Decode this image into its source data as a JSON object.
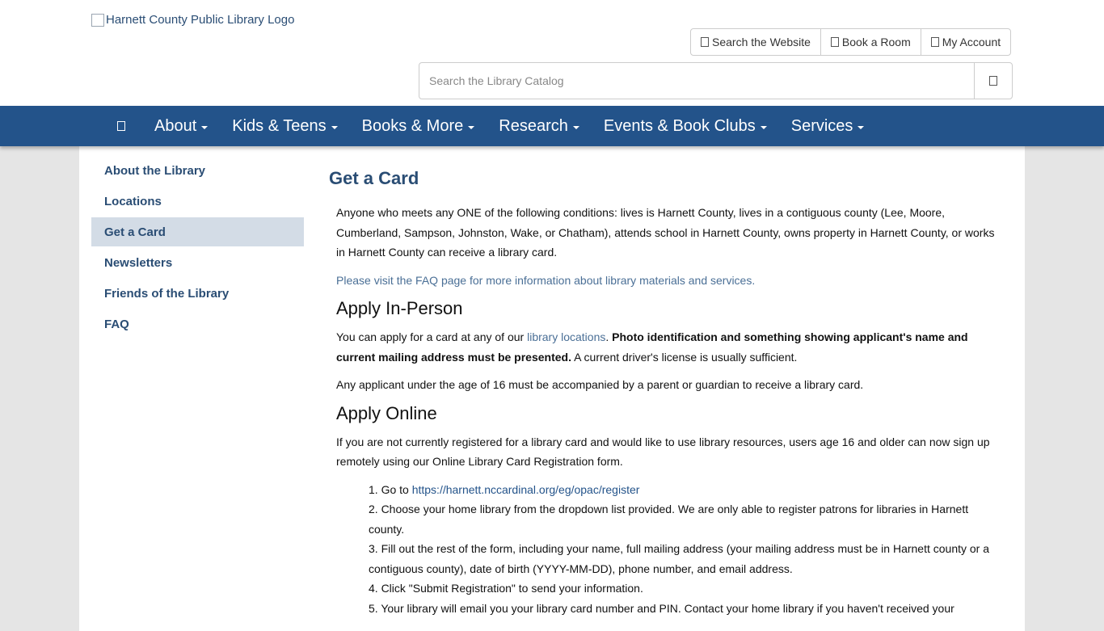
{
  "header": {
    "logo_alt": "Harnett County Public Library Logo",
    "util_buttons": [
      "Search the Website",
      "Book a Room",
      "My Account"
    ],
    "search_placeholder": "Search the Library Catalog"
  },
  "nav": {
    "items": [
      "About",
      "Kids & Teens",
      "Books & More",
      "Research",
      "Events & Book Clubs",
      "Services"
    ]
  },
  "sidebar": {
    "items": [
      "About the Library",
      "Locations",
      "Get a Card",
      "Newsletters",
      "Friends of the Library",
      "FAQ"
    ],
    "active": "Get a Card"
  },
  "main": {
    "title": "Get a Card",
    "intro": "Anyone who meets any ONE of the following conditions: lives is Harnett County, lives in a contiguous county (Lee, Moore, Cumberland, Sampson, Johnston, Wake, or Chatham), attends school in Harnett County, owns property in Harnett County, or works in Harnett County can receive a library card.",
    "faq_link": "Please visit the FAQ page for more information about library materials and services.",
    "in_person_heading": "Apply In-Person",
    "in_person_pre": "You can apply for a card at any of our ",
    "in_person_link": "library locations",
    "in_person_mid": ". ",
    "in_person_bold": "Photo identification and something showing applicant's name and current mailing address must be presented.",
    "in_person_post": " A current driver's license is usually sufficient.",
    "under16": "Any applicant under the age of 16 must be accompanied by a parent or guardian to receive a library card.",
    "online_heading": "Apply Online",
    "online_intro": "If you are not currently registered for a library card and would like to use library resources, users age 16 and older can now sign up remotely using our Online Library Card Registration form.",
    "step1_pre": "1. Go to ",
    "step1_link": "https://harnett.nccardinal.org/eg/opac/register",
    "step2": "2. Choose your home library from the dropdown list provided. We are only able to register patrons for libraries in Harnett county.",
    "step3": "3. Fill out the rest of the form, including your name, full mailing address (your mailing address must be in Harnett county or a contiguous county), date of birth (YYYY-MM-DD), phone number, and email address.",
    "step4": "4. Click \"Submit Registration\" to send your information.",
    "step5": "5. Your library will email you your library card number and PIN. Contact your home library if you haven't received your"
  },
  "colors": {
    "nav_bg": "#23538a",
    "link": "#2a4d74",
    "active_side": "#d3dce6"
  }
}
